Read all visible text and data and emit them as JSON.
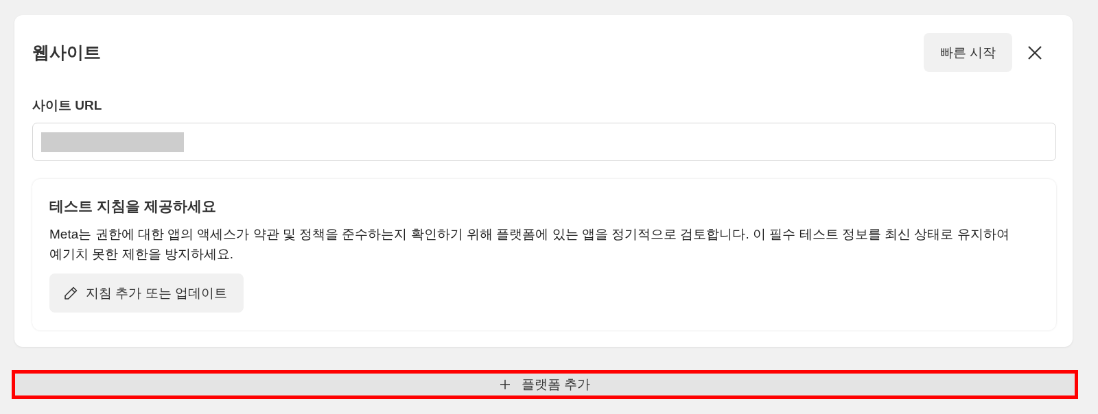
{
  "panel": {
    "title": "웹사이트",
    "quick_start_button": "빠른 시작",
    "site_url": {
      "label": "사이트 URL",
      "value_redacted": true
    },
    "test_instructions": {
      "title": "테스트 지침을 제공하세요",
      "body": "Meta는 권한에 대한 앱의 액세스가 약관 및 정책을 준수하는지 확인하기 위해 플랫폼에 있는 앱을 정기적으로 검토합니다. 이 필수 테스트 정보를 최신 상태로 유지하여 예기치 못한 제한을 방지하세요.",
      "button": "지침 추가 또는 업데이트"
    }
  },
  "add_platform_button": {
    "label": "플랫폼 추가",
    "highlighted": true
  }
}
